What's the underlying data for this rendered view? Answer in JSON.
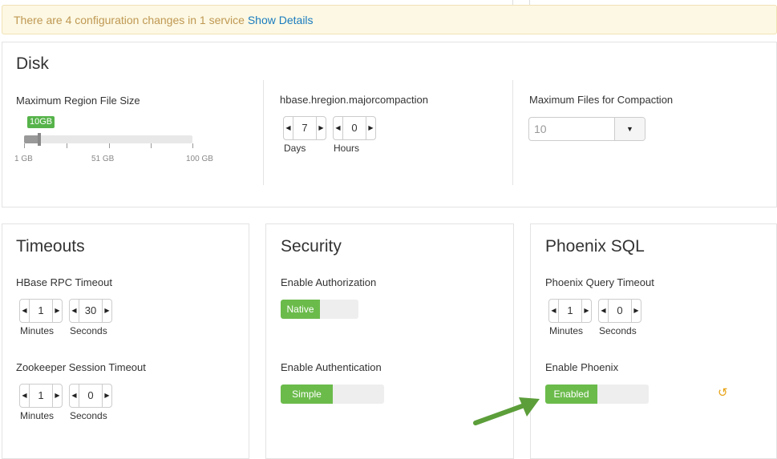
{
  "alert": {
    "text": "There are 4 configuration changes in 1 service",
    "link": "Show Details"
  },
  "disk": {
    "title": "Disk",
    "region_size": {
      "label": "Maximum Region File Size",
      "value_badge": "10GB",
      "value_gb": 10,
      "min_label": "1 GB",
      "mid_label": "51 GB",
      "max_label": "100 GB"
    },
    "major_compaction": {
      "label": "hbase.hregion.majorcompaction",
      "days": "7",
      "days_unit": "Days",
      "hours": "0",
      "hours_unit": "Hours"
    },
    "max_files": {
      "label": "Maximum Files for Compaction",
      "placeholder": "10"
    }
  },
  "timeouts": {
    "title": "Timeouts",
    "rpc": {
      "label": "HBase RPC Timeout",
      "minutes": "1",
      "minutes_unit": "Minutes",
      "seconds": "30",
      "seconds_unit": "Seconds"
    },
    "zookeeper": {
      "label": "Zookeeper Session Timeout",
      "minutes": "1",
      "minutes_unit": "Minutes",
      "seconds": "0",
      "seconds_unit": "Seconds"
    }
  },
  "security": {
    "title": "Security",
    "authorization": {
      "label": "Enable Authorization",
      "value": "Native"
    },
    "authentication": {
      "label": "Enable Authentication",
      "value": "Simple"
    }
  },
  "phoenix": {
    "title": "Phoenix SQL",
    "query_timeout": {
      "label": "Phoenix Query Timeout",
      "minutes": "1",
      "minutes_unit": "Minutes",
      "seconds": "0",
      "seconds_unit": "Seconds"
    },
    "enable": {
      "label": "Enable Phoenix",
      "value": "Enabled"
    }
  },
  "colors": {
    "accent_green": "#6bbb4b",
    "link_blue": "#1a7bbf",
    "alert_text": "#c09853",
    "undo_orange": "#e8a317"
  }
}
